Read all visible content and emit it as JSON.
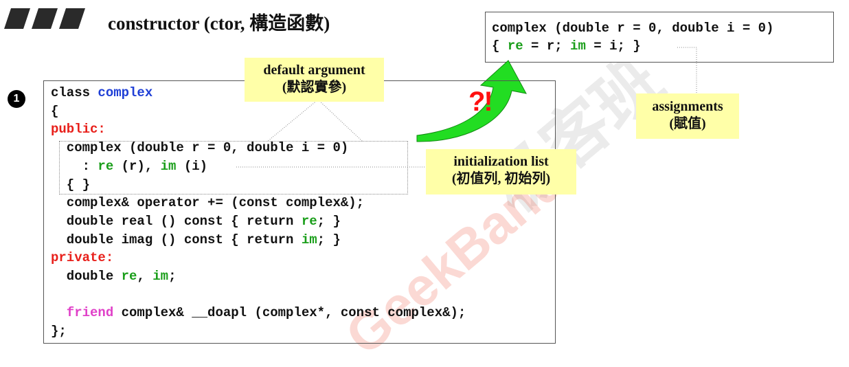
{
  "header": {
    "title": "constructor (ctor, 構造函數)"
  },
  "badge": {
    "number": "1"
  },
  "code": {
    "l1_kw": "class",
    "l1_name": "complex",
    "l2": "{",
    "l3": "public:",
    "l4": "  complex (double r = 0, double i = 0)",
    "l5_a": "    : ",
    "l5_re": "re",
    "l5_b": " (r), ",
    "l5_im": "im",
    "l5_c": " (i)",
    "l6": "  { }",
    "l7": "  complex& operator += (const complex&);",
    "l8_a": "  double real () const { return ",
    "l8_re": "re",
    "l8_b": "; }",
    "l9_a": "  double imag () const { return ",
    "l9_im": "im",
    "l9_b": "; }",
    "l10": "private:",
    "l11_a": "  double ",
    "l11_re": "re",
    "l11_b": ", ",
    "l11_im": "im",
    "l11_c": ";",
    "l13_friend": "  friend",
    "l13_rest": " complex& __doapl (complex*, const complex&);",
    "l14": "};"
  },
  "top_code": {
    "line1": "complex (double r = 0, double i = 0)",
    "line2_a": "{ ",
    "line2_re": "re",
    "line2_b": " = r; ",
    "line2_im": "im",
    "line2_c": " = i; }"
  },
  "notes": {
    "default_line1": "default argument",
    "default_line2": "(默認實參)",
    "init_line1": "initialization list",
    "init_line2": "(初值列, 初始列)",
    "assign_line1": "assignments",
    "assign_line2": "(賦值)"
  },
  "marks": {
    "question_exclaim": "?!"
  },
  "watermark": {
    "text": "GeekBand",
    "cn": "极客班"
  },
  "colors": {
    "keyword_blue": "#1f3fd6",
    "keyword_red": "#e8201b",
    "member_green": "#1a9e1a",
    "friend_pink": "#e040c8",
    "note_yellow": "#ffffa8",
    "arrow_green": "#22dd22"
  }
}
